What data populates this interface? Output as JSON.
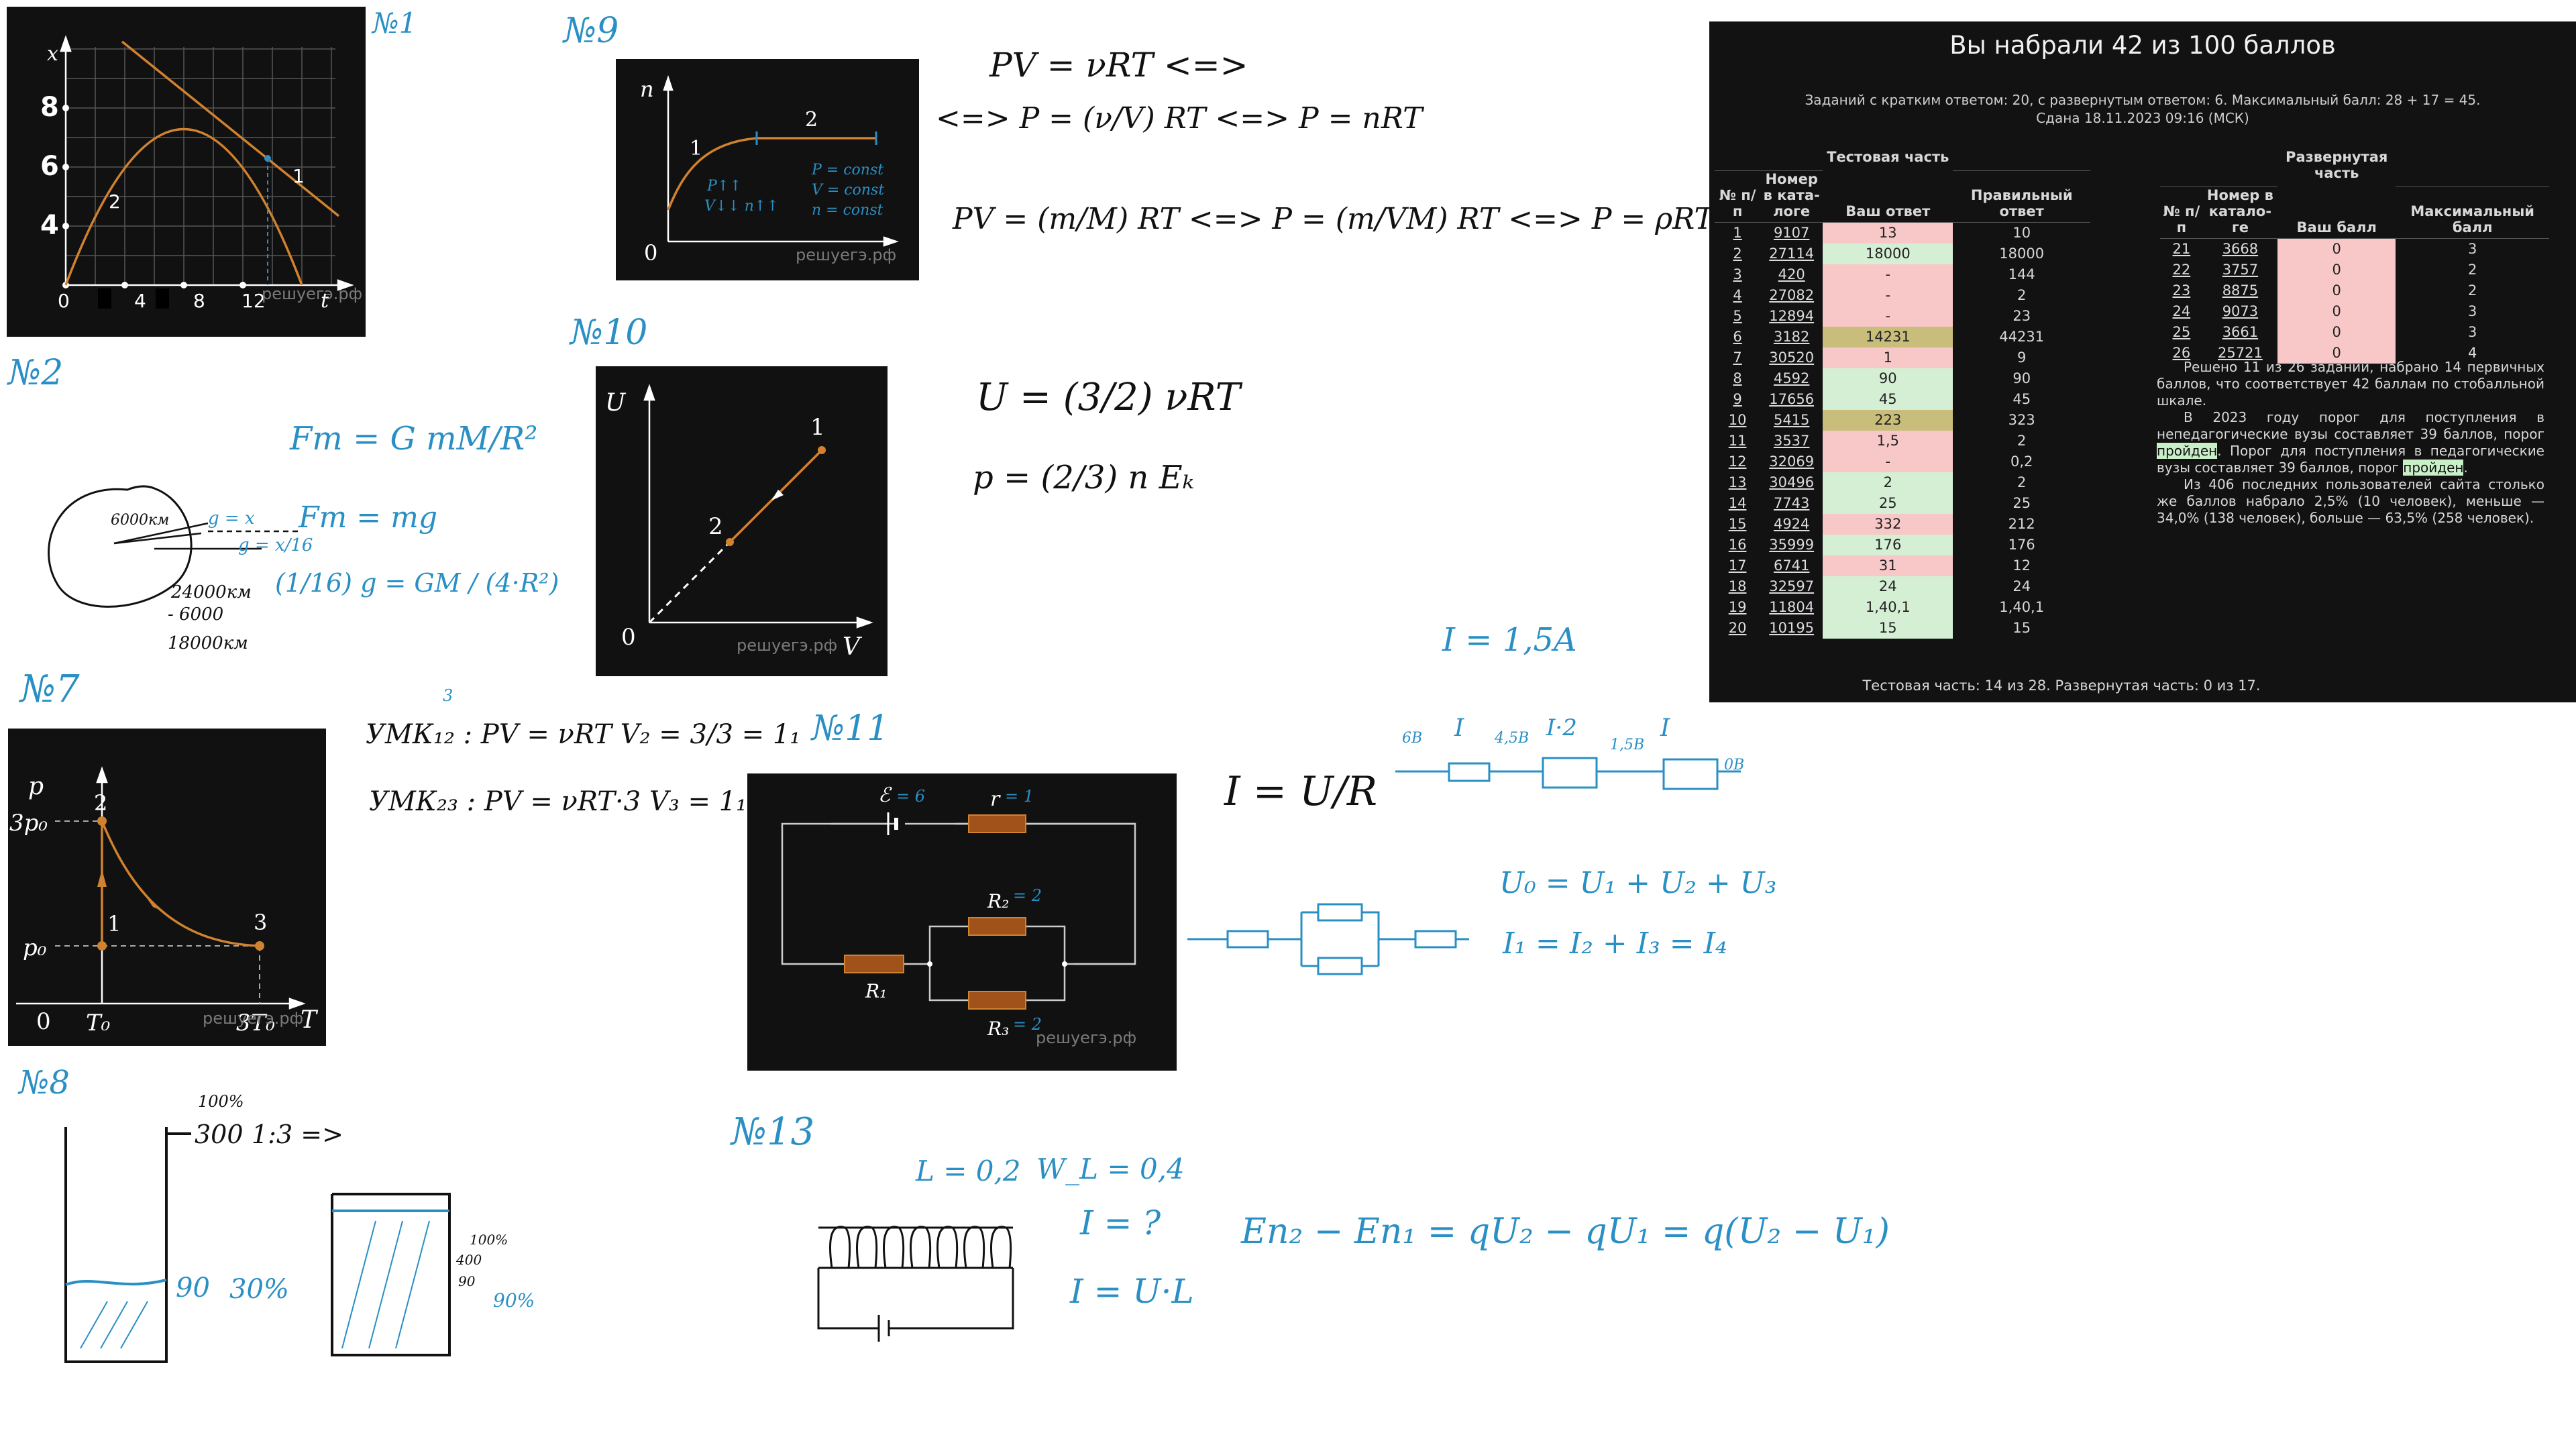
{
  "markers": {
    "n1": "№1",
    "n2": "№2",
    "n7": "№7",
    "n8": "№8",
    "n9": "№9",
    "n10": "№10",
    "n11": "№11",
    "n13": "№13"
  },
  "watermark": "решуегэ.рф",
  "p1": {
    "axis_x": "t",
    "axis_y": "x",
    "y_ticks": [
      "8",
      "6",
      "4"
    ],
    "x_ticks": [
      "0",
      "4",
      "8",
      "12"
    ],
    "label_1": "1",
    "label_2": "2"
  },
  "p9": {
    "axis_y": "n",
    "origin": "0",
    "label_1": "1",
    "label_2": "2",
    "ink_1": "P↑↑",
    "ink_2": "V↓↓ n↑↑",
    "ink_3": "P = const",
    "ink_4": "V = const",
    "ink_5": "n = const"
  },
  "p10": {
    "axis_y": "U",
    "axis_x": "V",
    "origin": "0",
    "label_1": "1",
    "label_2": "2"
  },
  "p7": {
    "axis_y": "p",
    "axis_x": "T",
    "origin": "0",
    "y_ticks": [
      "3p₀",
      "p₀"
    ],
    "x_ticks": [
      "T₀",
      "3T₀"
    ],
    "label_1": "1",
    "label_2": "2",
    "label_3": "3"
  },
  "p11": {
    "emf": "ℰ",
    "emf_val": "= 6",
    "r": "r",
    "r_val": "= 1",
    "R1": "R₁",
    "R2": "R₂",
    "R2_val": "= 2",
    "R3": "R₃",
    "R3_val": "= 2"
  },
  "notes": {
    "n9_eq1": "PV = νRT <=>",
    "n9_eq2": "<=> P = (ν/V) RT <=> P = nRT",
    "n9_eq3": "PV = (m/M) RT <=> P = (m/VM) RT <=> P = ρRT/M",
    "n10_eq1": "U = (3/2) νRT",
    "n10_eq2": "p = (2/3) n Eₖ",
    "n2_eq1": "Fт = G mM/R²",
    "n2_eq2": "Fт = mg",
    "n2_eq3": "(1/16) g = GM / (4·R²)",
    "n2_r1": "6000км",
    "n2_g1": "g = x",
    "n2_g2": "g = x/16",
    "n2_calc1": "24000км",
    "n2_calc2": "- 6000",
    "n2_calc3": "18000км",
    "n7_l1": "УМК₁₂ : PV = νRT   V₂ = 3/3 = 1₁",
    "n7_l2": "УМК₂₃ : PV = νRT·3   V₃ = 1₁",
    "n7_three": "3",
    "n8_100": "100%",
    "n8_300": "300",
    "n8_ratio": "1:3 =>",
    "n8_90": "90",
    "n8_30": "30%",
    "n8_s100": "100%",
    "n8_s400": "400",
    "n8_s90": "90",
    "n8_s90p": "90%",
    "ohm": "I = U/R",
    "i15": "I = 1,5A",
    "ch_6v": "6В",
    "ch_I": "I",
    "ch_45": "4,5В",
    "ch_I2": "I·2",
    "ch_15": "1,5В",
    "ch_0v": "0В",
    "sum_u": "U₀ = U₁ + U₂ + U₃",
    "sum_i": "I₁ = I₂ + I₃ = I₄",
    "n13_L": "L = 0,2",
    "n13_W": "W_L = 0,4",
    "n13_I": "I = ?",
    "n13_f": "I = U·L",
    "energy": "Eп₂ − Eп₁ = qU₂ − qU₁ = q(U₂ − U₁)"
  },
  "results": {
    "title": "Вы набрали 42 из 100 баллов",
    "info_1": "Заданий с кратким ответом: 20, с развернутым ответом: 6. Максимальный балл: 28 + 17 = 45.",
    "info_2": "Сдана 18.11.2023 09:16 (МСК)",
    "test_caption": "Тестовая часть",
    "test_headers": [
      "№ п/п",
      "Номер в ката­логе",
      "Ваш ответ",
      "Правильный ответ"
    ],
    "test_rows": [
      {
        "n": "1",
        "cat": "9107",
        "ans": "13",
        "right": "10",
        "st": "bad"
      },
      {
        "n": "2",
        "cat": "27114",
        "ans": "18000",
        "right": "18000",
        "st": "ok"
      },
      {
        "n": "3",
        "cat": "420",
        "ans": "-",
        "right": "144",
        "st": "bad"
      },
      {
        "n": "4",
        "cat": "27082",
        "ans": "-",
        "right": "2",
        "st": "bad"
      },
      {
        "n": "5",
        "cat": "12894",
        "ans": "-",
        "right": "23",
        "st": "bad"
      },
      {
        "n": "6",
        "cat": "3182",
        "ans": "14231",
        "right": "44231",
        "st": "part"
      },
      {
        "n": "7",
        "cat": "30520",
        "ans": "1",
        "right": "9",
        "st": "bad"
      },
      {
        "n": "8",
        "cat": "4592",
        "ans": "90",
        "right": "90",
        "st": "ok"
      },
      {
        "n": "9",
        "cat": "17656",
        "ans": "45",
        "right": "45",
        "st": "ok"
      },
      {
        "n": "10",
        "cat": "5415",
        "ans": "223",
        "right": "323",
        "st": "part"
      },
      {
        "n": "11",
        "cat": "3537",
        "ans": "1,5",
        "right": "2",
        "st": "bad"
      },
      {
        "n": "12",
        "cat": "32069",
        "ans": "-",
        "right": "0,2",
        "st": "bad"
      },
      {
        "n": "13",
        "cat": "30496",
        "ans": "2",
        "right": "2",
        "st": "ok"
      },
      {
        "n": "14",
        "cat": "7743",
        "ans": "25",
        "right": "25",
        "st": "ok"
      },
      {
        "n": "15",
        "cat": "4924",
        "ans": "332",
        "right": "212",
        "st": "bad"
      },
      {
        "n": "16",
        "cat": "35999",
        "ans": "176",
        "right": "176",
        "st": "ok"
      },
      {
        "n": "17",
        "cat": "6741",
        "ans": "31",
        "right": "12",
        "st": "bad"
      },
      {
        "n": "18",
        "cat": "32597",
        "ans": "24",
        "right": "24",
        "st": "ok"
      },
      {
        "n": "19",
        "cat": "11804",
        "ans": "1,40,1",
        "right": "1,40,1",
        "st": "ok"
      },
      {
        "n": "20",
        "cat": "10195",
        "ans": "15",
        "right": "15",
        "st": "ok"
      }
    ],
    "ext_caption": "Развернутая часть",
    "ext_headers": [
      "№ п/п",
      "Номер в катало­ге",
      "Ваш балл",
      "Максимальный балл"
    ],
    "ext_rows": [
      {
        "n": "21",
        "cat": "3668",
        "score": "0",
        "max": "3"
      },
      {
        "n": "22",
        "cat": "3757",
        "score": "0",
        "max": "2"
      },
      {
        "n": "23",
        "cat": "8875",
        "score": "0",
        "max": "2"
      },
      {
        "n": "24",
        "cat": "9073",
        "score": "0",
        "max": "3"
      },
      {
        "n": "25",
        "cat": "3661",
        "score": "0",
        "max": "3"
      },
      {
        "n": "26",
        "cat": "25721",
        "score": "0",
        "max": "4"
      }
    ],
    "summary_1": "Решено 11 из 26 заданий, набрано 14 первичных баллов, что соответствует 42 баллам по стобалльной шкале.",
    "summary_2a": "В 2023 году порог для поступления в непедагогические вузы составляет 39 баллов, порог ",
    "summary_2b": "пройден",
    "summary_2c": ". Порог для поступления в педагогические вузы составляет 39 баллов, порог ",
    "summary_2d": "пройден",
    "summary_2e": ".",
    "summary_3": "Из 406 последних пользователей сайта столько же баллов набрало 2,5% (10 человек), меньше — 34,0% (138 человек), больше — 63,5% (258 человек).",
    "footer": "Тестовая часть: 14 из 28. Развернутая часть: 0 из 17."
  }
}
